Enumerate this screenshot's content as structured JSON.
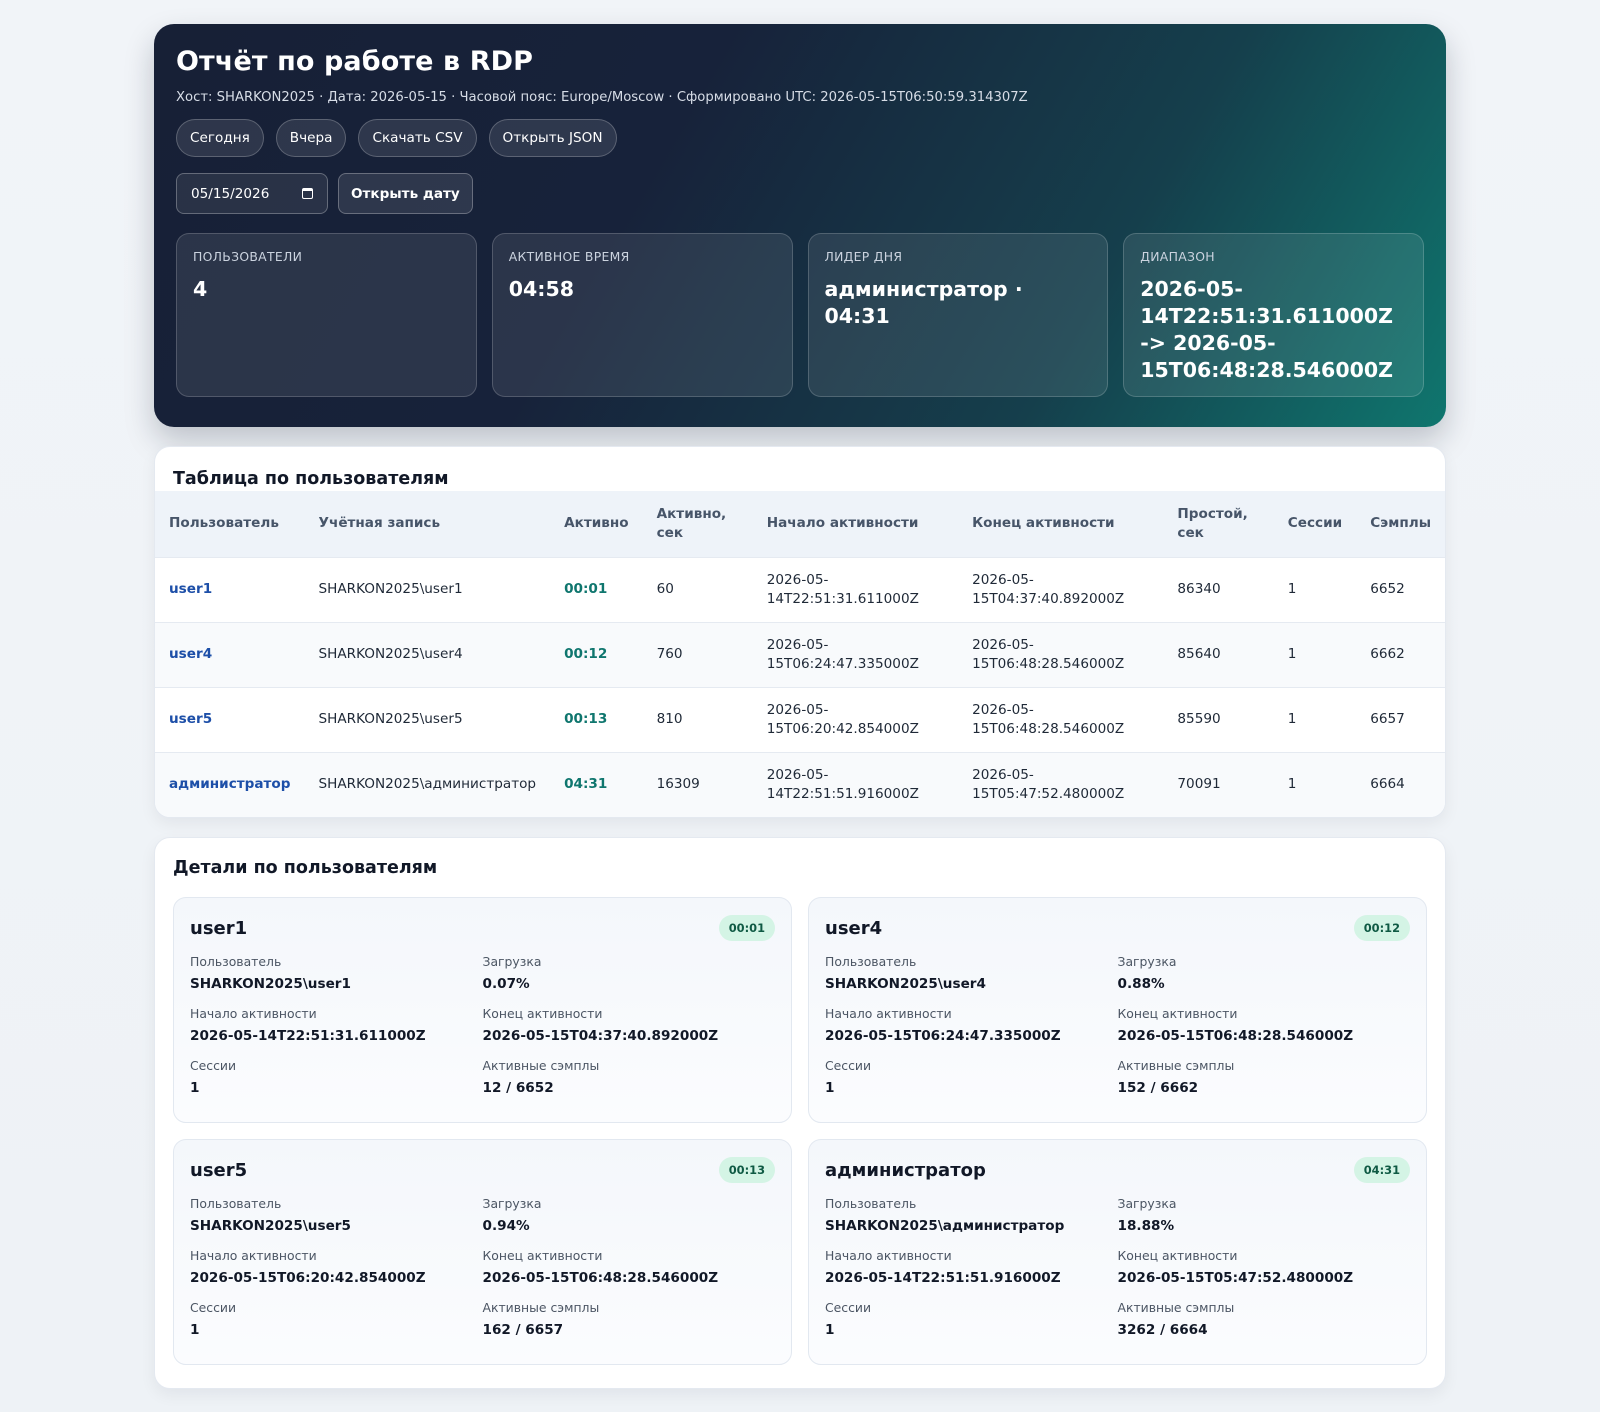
{
  "header": {
    "title": "Отчёт по работе в RDP",
    "meta": "Хост: SHARKON2025 · Дата: 2026-05-15 · Часовой пояс: Europe/Moscow · Сформировано UTC: 2026-05-15T06:50:59.314307Z",
    "buttons": [
      "Сегодня",
      "Вчера",
      "Скачать CSV",
      "Открыть JSON"
    ],
    "date_value": "05/15/2026",
    "open_date_label": "Открыть дату"
  },
  "stats": [
    {
      "label": "ПОЛЬЗОВАТЕЛИ",
      "value": "4"
    },
    {
      "label": "АКТИВНОЕ ВРЕМЯ",
      "value": "04:58"
    },
    {
      "label": "ЛИДЕР ДНЯ",
      "value": "администратор · 04:31"
    },
    {
      "label": "ДИАПАЗОН",
      "value": "2026-05-14T22:51:31.611000Z -> 2026-05-15T06:48:28.546000Z"
    }
  ],
  "table": {
    "title": "Таблица по пользователям",
    "columns": [
      "Пользователь",
      "Учётная запись",
      "Активно",
      "Активно, сек",
      "Начало активности",
      "Конец активности",
      "Простой, сек",
      "Сессии",
      "Сэмплы"
    ],
    "rows": [
      {
        "user": "user1",
        "account": "SHARKON2025\\user1",
        "active": "00:01",
        "active_sec": "60",
        "start": "2026-05-14T22:51:31.611000Z",
        "end": "2026-05-15T04:37:40.892000Z",
        "idle_sec": "86340",
        "sessions": "1",
        "samples": "6652"
      },
      {
        "user": "user4",
        "account": "SHARKON2025\\user4",
        "active": "00:12",
        "active_sec": "760",
        "start": "2026-05-15T06:24:47.335000Z",
        "end": "2026-05-15T06:48:28.546000Z",
        "idle_sec": "85640",
        "sessions": "1",
        "samples": "6662"
      },
      {
        "user": "user5",
        "account": "SHARKON2025\\user5",
        "active": "00:13",
        "active_sec": "810",
        "start": "2026-05-15T06:20:42.854000Z",
        "end": "2026-05-15T06:48:28.546000Z",
        "idle_sec": "85590",
        "sessions": "1",
        "samples": "6657"
      },
      {
        "user": "администратор",
        "account": "SHARKON2025\\администратор",
        "active": "04:31",
        "active_sec": "16309",
        "start": "2026-05-14T22:51:51.916000Z",
        "end": "2026-05-15T05:47:52.480000Z",
        "idle_sec": "70091",
        "sessions": "1",
        "samples": "6664"
      }
    ]
  },
  "details": {
    "title": "Детали по пользователям",
    "labels": {
      "user": "Пользователь",
      "load": "Загрузка",
      "start": "Начало активности",
      "end": "Конец активности",
      "sessions": "Сессии",
      "active_samples": "Активные сэмплы"
    },
    "cards": [
      {
        "name": "user1",
        "badge": "00:01",
        "user": "SHARKON2025\\user1",
        "load": "0.07%",
        "start": "2026-05-14T22:51:31.611000Z",
        "end": "2026-05-15T04:37:40.892000Z",
        "sessions": "1",
        "active_samples": "12 / 6652"
      },
      {
        "name": "user4",
        "badge": "00:12",
        "user": "SHARKON2025\\user4",
        "load": "0.88%",
        "start": "2026-05-15T06:24:47.335000Z",
        "end": "2026-05-15T06:48:28.546000Z",
        "sessions": "1",
        "active_samples": "152 / 6662"
      },
      {
        "name": "user5",
        "badge": "00:13",
        "user": "SHARKON2025\\user5",
        "load": "0.94%",
        "start": "2026-05-15T06:20:42.854000Z",
        "end": "2026-05-15T06:48:28.546000Z",
        "sessions": "1",
        "active_samples": "162 / 6657"
      },
      {
        "name": "администратор",
        "badge": "04:31",
        "user": "SHARKON2025\\администратор",
        "load": "18.88%",
        "start": "2026-05-14T22:51:51.916000Z",
        "end": "2026-05-15T05:47:52.480000Z",
        "sessions": "1",
        "active_samples": "3262 / 6664"
      }
    ]
  }
}
